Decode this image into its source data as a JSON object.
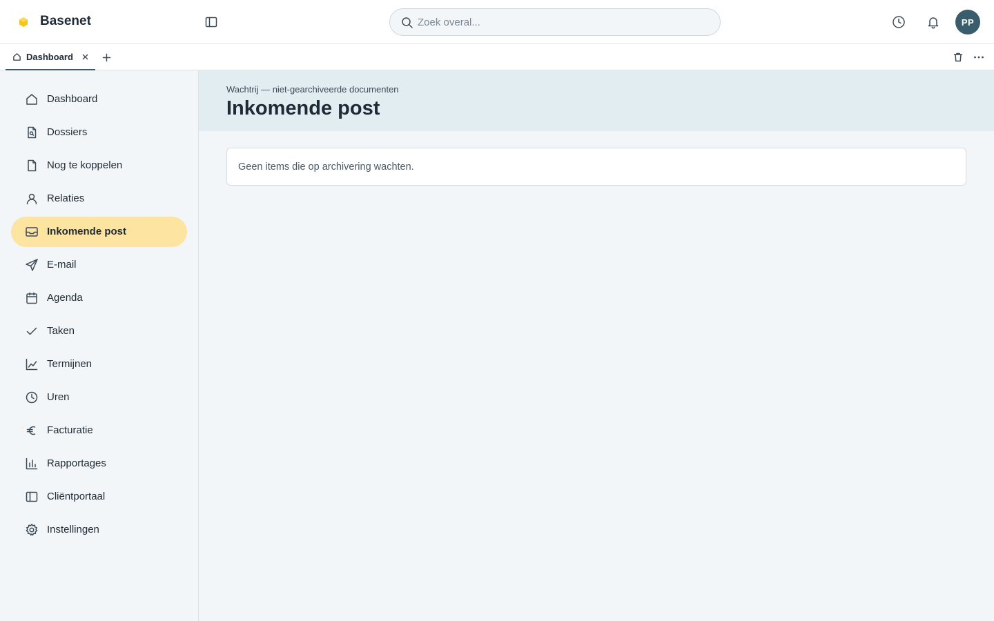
{
  "header": {
    "brand": "Basenet",
    "search_placeholder": "Zoek overal...",
    "avatar_initials": "PP"
  },
  "tabs": [
    {
      "label": "Dashboard",
      "icon": "home-icon",
      "active": true
    }
  ],
  "sidebar": {
    "items": [
      {
        "label": "Dashboard",
        "icon": "home-icon"
      },
      {
        "label": "Dossiers",
        "icon": "file-search-icon"
      },
      {
        "label": "Nog te koppelen",
        "icon": "file-icon"
      },
      {
        "label": "Relaties",
        "icon": "user-icon"
      },
      {
        "label": "Inkomende post",
        "icon": "inbox-icon",
        "active": true
      },
      {
        "label": "E-mail",
        "icon": "send-icon"
      },
      {
        "label": "Agenda",
        "icon": "calendar-icon"
      },
      {
        "label": "Taken",
        "icon": "check-icon"
      },
      {
        "label": "Termijnen",
        "icon": "line-chart-icon"
      },
      {
        "label": "Uren",
        "icon": "clock-icon"
      },
      {
        "label": "Facturatie",
        "icon": "euro-icon"
      },
      {
        "label": "Rapportages",
        "icon": "bar-chart-icon"
      },
      {
        "label": "Cliëntportaal",
        "icon": "panel-icon"
      },
      {
        "label": "Instellingen",
        "icon": "gear-icon"
      }
    ]
  },
  "main": {
    "subtitle": "Wachtrij — niet-gearchiveerde documenten",
    "title": "Inkomende post",
    "empty_message": "Geen items die op archivering wachten."
  },
  "colors": {
    "accent_active": "#fde4a0",
    "avatar": "#3a5d6e",
    "logo": "#f5c518"
  }
}
